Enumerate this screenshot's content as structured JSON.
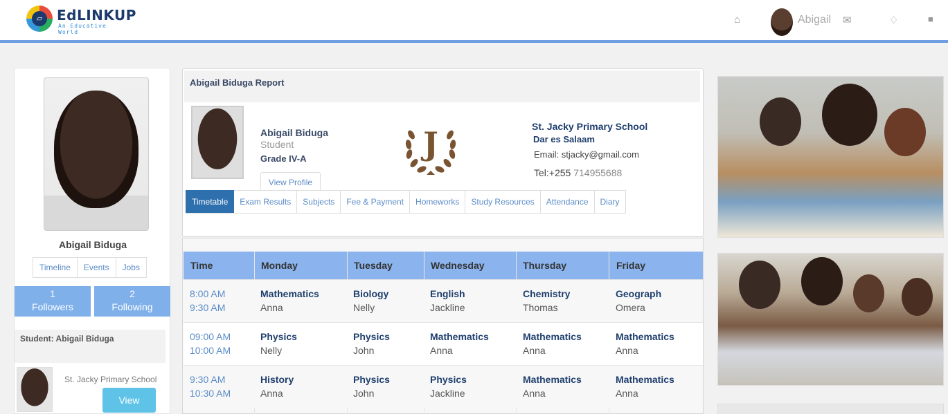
{
  "header": {
    "logo_name": "EdLINKUP",
    "logo_tagline": "An Educative World",
    "user_name": "Abigail",
    "icons": [
      "home-icon",
      "envelope-icon",
      "bell-icon",
      "lock-icon"
    ],
    "accent_color": "#6f9fe0"
  },
  "profile": {
    "name": "Abigail Biduga",
    "tabs": [
      "Timeline",
      "Events",
      "Jobs"
    ],
    "followers_count": "1",
    "followers_label": "Followers",
    "following_count": "2",
    "following_label": "Following",
    "student_label": "Student:  Abigail Biduga",
    "school": "St. Jacky Primary School",
    "view_label": "View"
  },
  "report": {
    "title": "Abigail Biduga Report",
    "student_name": "Abigail Biduga",
    "role": "Student",
    "grade": "Grade IV-A",
    "view_profile": "View Profile",
    "crest_letter": "J",
    "school_name": "St. Jacky Primary School",
    "school_city": "Dar es Salaam",
    "email": "Email: stjacky@gmail.com",
    "tel_prefix": "Tel:+255",
    "tel_number": "714955688",
    "tabs": [
      "Timetable",
      "Exam Results",
      "Subjects",
      "Fee & Payment",
      "Homeworks",
      "Study Resources",
      "Attendance",
      "Diary"
    ],
    "active_tab": "Timetable"
  },
  "timetable": {
    "headers": [
      "Time",
      "Monday",
      "Tuesday",
      "Wednesday",
      "Thursday",
      "Friday"
    ],
    "rows": [
      {
        "start": "8:00 AM",
        "end": "9:30 AM",
        "cells": [
          [
            "Mathematics",
            "Anna"
          ],
          [
            "Biology",
            "Nelly"
          ],
          [
            "English",
            "Jackline"
          ],
          [
            "Chemistry",
            "Thomas"
          ],
          [
            "Geograph",
            "Omera"
          ]
        ]
      },
      {
        "start": "09:00 AM",
        "end": "10:00 AM",
        "cells": [
          [
            "Physics",
            "Nelly"
          ],
          [
            "Physics",
            "John"
          ],
          [
            "Mathematics",
            "Anna"
          ],
          [
            "Mathematics",
            "Anna"
          ],
          [
            "Mathematics",
            "Anna"
          ]
        ]
      },
      {
        "start": "9:30 AM",
        "end": "10:30 AM",
        "cells": [
          [
            "History",
            "Anna"
          ],
          [
            "Physics",
            "John"
          ],
          [
            "Physics",
            "Jackline"
          ],
          [
            "Mathematics",
            "Anna"
          ],
          [
            "Mathematics",
            "Anna"
          ]
        ]
      }
    ]
  }
}
